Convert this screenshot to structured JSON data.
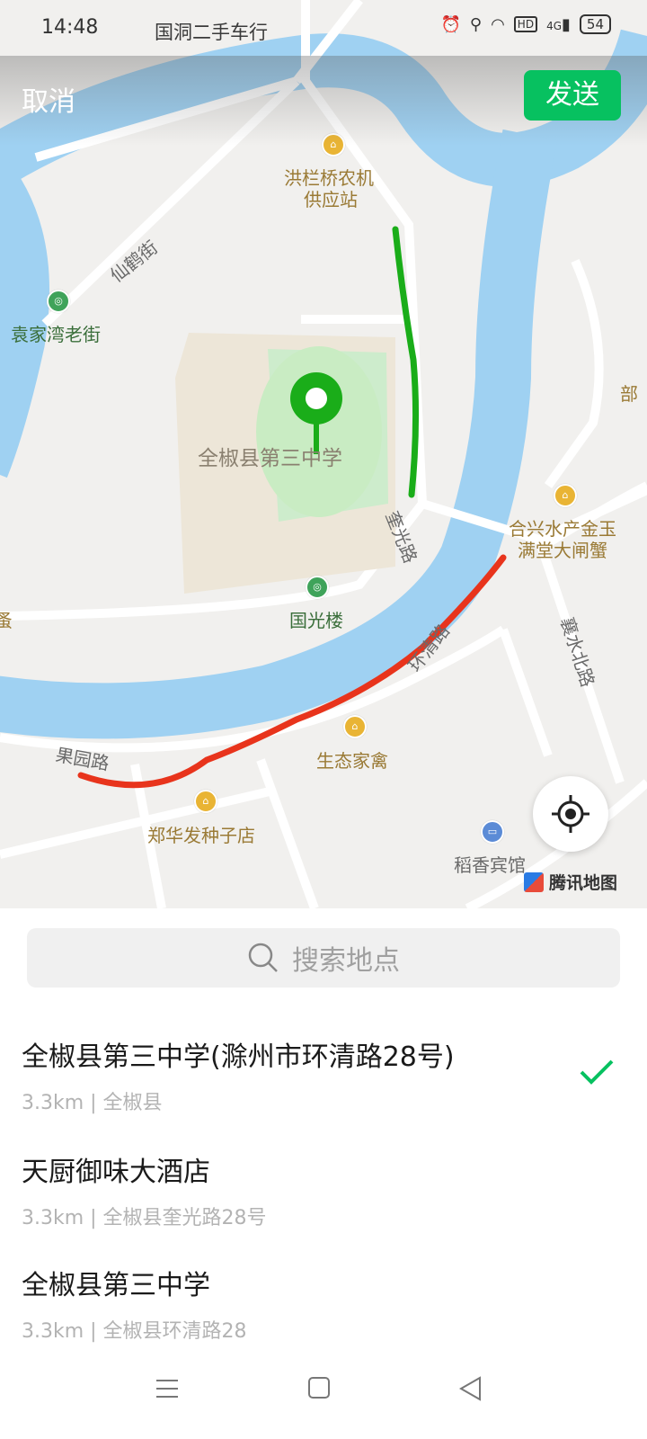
{
  "status_bar": {
    "time": "14:48",
    "ticker": "国洞二手车行",
    "network": "4G",
    "battery": "54",
    "icons": [
      "alarm-icon",
      "location-icon",
      "wifi-icon",
      "hd-icon",
      "signal-icon",
      "battery-icon"
    ]
  },
  "header": {
    "cancel_label": "取消",
    "send_label": "发送",
    "accent": "#07c160"
  },
  "map": {
    "labels": {
      "hongl": "洪栏桥农机",
      "hongl2": "供应站",
      "xianhe": "仙鹤街",
      "yuanjia": "袁家湾老街",
      "school": "全椒县第三中学",
      "kuiguang": "奎光路",
      "guoguang": "国光楼",
      "hexing1": "合兴水产金玉",
      "hexing2": "满堂大闸蟹",
      "xiangshui": "襄水北路",
      "huanqing": "环清路",
      "shengtai": "生态家禽",
      "guoyuan": "果园路",
      "zhenghua": "郑华发种子店",
      "daoxiang": "稻香宾馆",
      "partial_right": "部",
      "partial_left": "蚤"
    },
    "brand": "腾讯地图",
    "colors": {
      "water": "#9fd1f2",
      "park": "#cdeccc",
      "campus": "#ede6d8",
      "green_stroke": "#1aad19",
      "red_stroke": "#e8341c"
    }
  },
  "search": {
    "placeholder": "搜索地点"
  },
  "results": [
    {
      "name": "全椒县第三中学(滁州市环清路28号)",
      "detail": "3.3km | 全椒县",
      "selected": true
    },
    {
      "name": "天厨御味大酒店",
      "detail": "3.3km | 全椒县奎光路28号",
      "selected": false
    },
    {
      "name": "全椒县第三中学",
      "detail": "3.3km | 全椒县环清路28",
      "selected": false
    }
  ],
  "nav": {
    "icons": [
      "menu-icon",
      "home-icon",
      "back-icon"
    ]
  }
}
